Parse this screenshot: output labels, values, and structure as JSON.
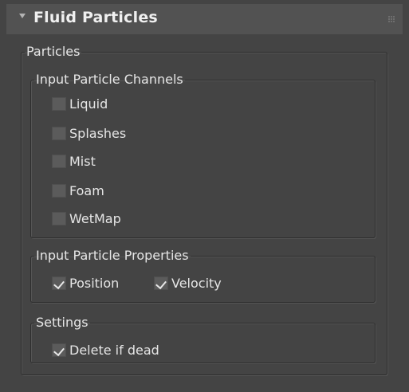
{
  "rollout": {
    "title": "Fluid Particles",
    "groups": {
      "particles": {
        "label": "Particles"
      },
      "channels": {
        "label": "Input Particle Channels",
        "items": [
          {
            "label": "Liquid",
            "checked": false
          },
          {
            "label": "Splashes",
            "checked": false
          },
          {
            "label": "Mist",
            "checked": false
          },
          {
            "label": "Foam",
            "checked": false
          },
          {
            "label": "WetMap",
            "checked": false
          }
        ]
      },
      "properties": {
        "label": "Input Particle Properties",
        "items": [
          {
            "label": "Position",
            "checked": true
          },
          {
            "label": "Velocity",
            "checked": true
          }
        ]
      },
      "settings": {
        "label": "Settings",
        "items": [
          {
            "label": "Delete if dead",
            "checked": true
          }
        ]
      }
    }
  }
}
